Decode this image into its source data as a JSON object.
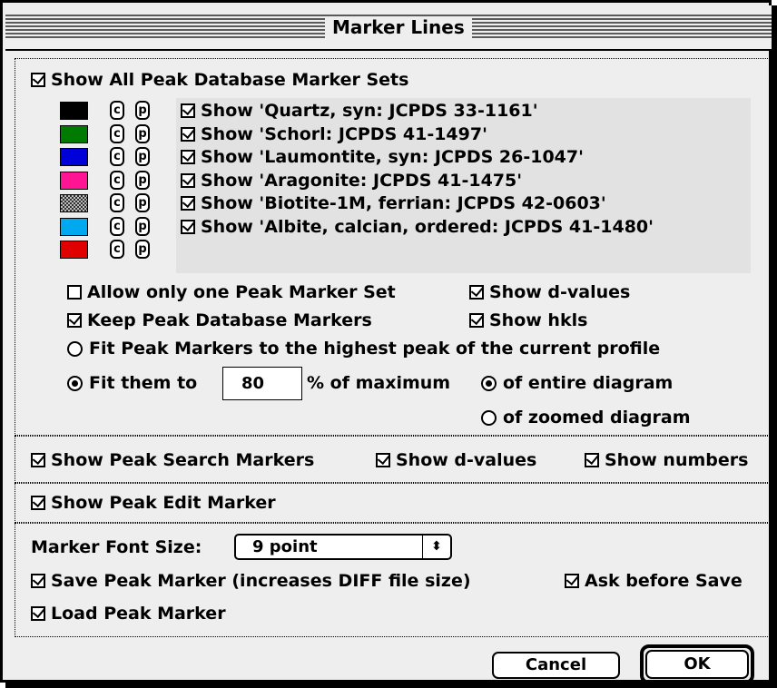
{
  "window": {
    "title": "Marker Lines"
  },
  "peak_database": {
    "show_all_label": "Show All Peak Database Marker Sets",
    "show_all_checked": true,
    "sets": [
      {
        "color": "#000000",
        "c": "c",
        "p": "p",
        "label": "Show 'Quartz, syn: JCPDS 33-1161'",
        "checked": true
      },
      {
        "color": "#007a00",
        "c": "c",
        "p": "p",
        "label": "Show 'Schorl: JCPDS 41-1497'",
        "checked": true
      },
      {
        "color": "#0000d8",
        "c": "c",
        "p": "p",
        "label": "Show 'Laumontite, syn: JCPDS 26-1047'",
        "checked": true
      },
      {
        "color": "#ff1493",
        "c": "c",
        "p": "p",
        "label": "Show 'Aragonite: JCPDS 41-1475'",
        "checked": true
      },
      {
        "color": "pattern-gray",
        "c": "c",
        "p": "p",
        "label": "Show 'Biotite-1M, ferrian: JCPDS 42-0603'",
        "checked": true
      },
      {
        "color": "#00a8f0",
        "c": "c",
        "p": "p",
        "label": "Show 'Albite, calcian, ordered: JCPDS 41-1480'",
        "checked": true
      },
      {
        "color": "#e00000",
        "c": "c",
        "p": "p",
        "label": "",
        "checked": false
      }
    ],
    "allow_one_label": "Allow only one Peak Marker Set",
    "allow_one_checked": false,
    "keep_label": "Keep Peak Database Markers",
    "keep_checked": true,
    "show_dvalues_label": "Show d-values",
    "show_dvalues_checked": true,
    "show_hkls_label": "Show hkls",
    "show_hkls_checked": true,
    "fit_highest_label": "Fit Peak Markers to the highest peak of the current profile",
    "fit_highest_selected": false,
    "fit_them_label": "Fit them to",
    "fit_them_selected": true,
    "fit_percent_value": "80",
    "percent_suffix": "% of maximum",
    "entire_label": "of entire diagram",
    "entire_selected": true,
    "zoomed_label": "of zoomed diagram",
    "zoomed_selected": false
  },
  "peak_search": {
    "show_label": "Show Peak Search Markers",
    "dvalues_label": "Show d-values",
    "numbers_label": "Show numbers"
  },
  "peak_edit": {
    "show_label": "Show Peak Edit Marker"
  },
  "font": {
    "label": "Marker Font Size:",
    "value": "9 point",
    "arrows": "⬍"
  },
  "save": {
    "save_label": "Save Peak Marker (increases DIFF file size)",
    "ask_label": "Ask before Save",
    "load_label": "Load Peak Marker"
  },
  "buttons": {
    "cancel": "Cancel",
    "ok": "OK"
  }
}
